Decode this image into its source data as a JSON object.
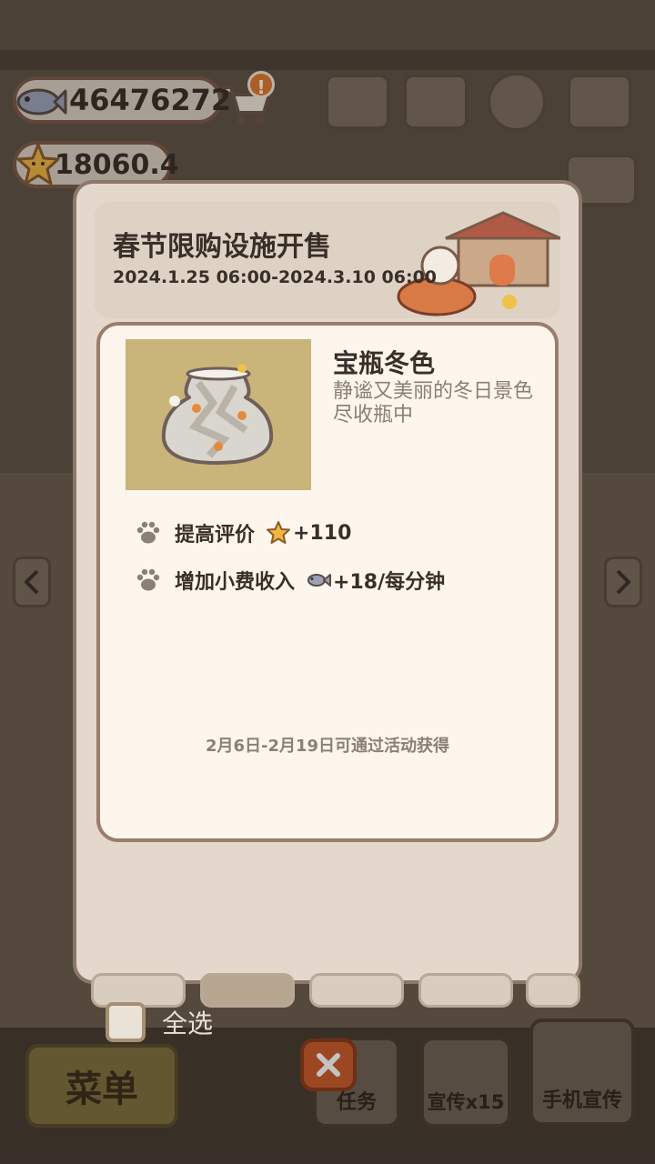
{
  "hud": {
    "fish_amount": "46476272",
    "star_amount": "18060.4",
    "cart_alert": "!"
  },
  "event": {
    "title": "春节限购设施开售",
    "dates": "2024.1.25 06:00-2024.3.10 06:00"
  },
  "item": {
    "name": "宝瓶冬色",
    "description": "静谧又美丽的冬日景色尽收瓶中",
    "stats": [
      {
        "label": "提高评价",
        "icon": "star-icon",
        "value": "+110"
      },
      {
        "label": "增加小费收入",
        "icon": "fish-icon",
        "value": "+18/每分钟"
      }
    ],
    "obtain_note": "2月6日-2月19日可通过活动获得"
  },
  "footer": {
    "select_all_label": "全选",
    "menu_label": "菜单",
    "task_label": "任务",
    "promo_label": "宣传x15",
    "phone_promo_label": "手机宣传"
  },
  "colors": {
    "card_bg": "#fdf6ec",
    "card_border": "#9a7d6c",
    "accent_orange": "#e0782e",
    "close_red": "#c85a2a"
  }
}
